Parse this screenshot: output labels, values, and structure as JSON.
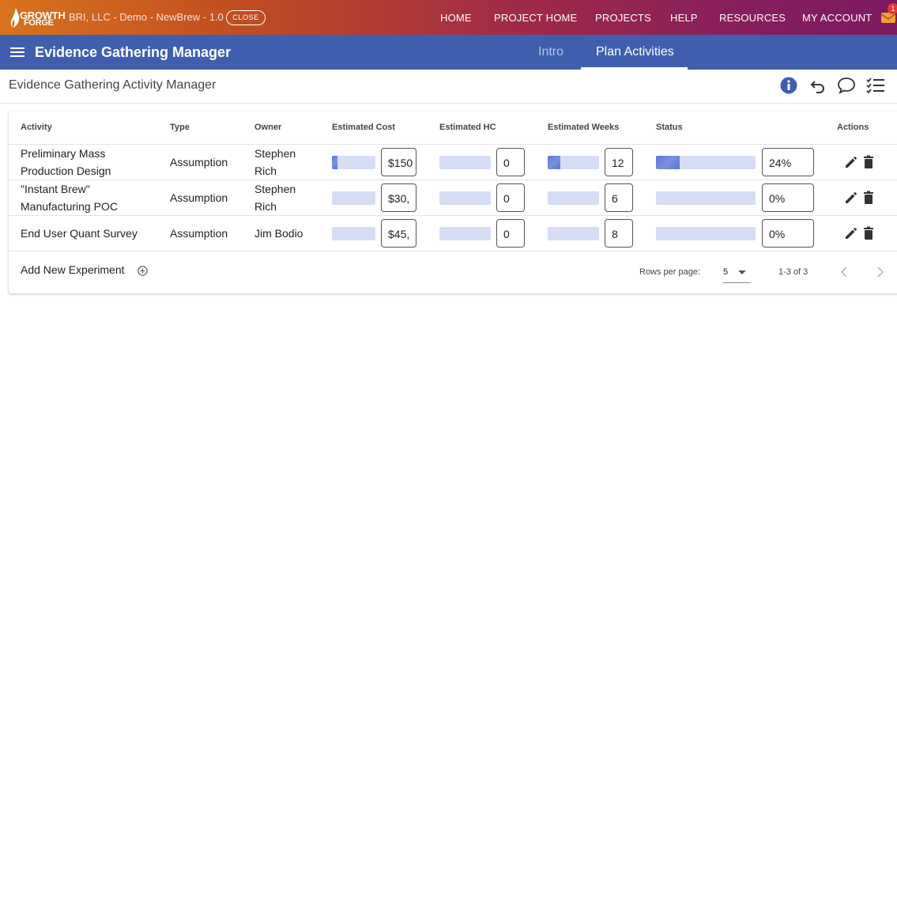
{
  "topbar": {
    "logo_line1": "GROWTH",
    "logo_line2": "FORGE",
    "project_name": "BRI, LLC - Demo - NewBrew - 1.0",
    "close_label": "CLOSE",
    "nav": [
      "HOME",
      "PROJECT HOME",
      "PROJECTS",
      "HELP",
      "RESOURCES",
      "MY ACCOUNT"
    ],
    "mail_badge": "1",
    "gradient_colors": [
      "#d9731c",
      "#7d1a60"
    ]
  },
  "appbar": {
    "title": "Evidence Gathering Manager",
    "tabs": [
      {
        "label": "Intro",
        "active": false
      },
      {
        "label": "Plan Activities",
        "active": true
      }
    ],
    "color": "#3f5fae"
  },
  "subheader": {
    "title": "Evidence Gathering Activity Manager",
    "tools": [
      "info-icon",
      "undo-icon",
      "comment-icon",
      "checklist-icon"
    ]
  },
  "table": {
    "headers": [
      "Activity",
      "Type",
      "Owner",
      "Estimated Cost",
      "Estimated HC",
      "Estimated Weeks",
      "Status",
      "Actions"
    ],
    "rows": [
      {
        "activity_line1": "Preliminary Mass",
        "activity_line2": "Production Design",
        "type": "Assumption",
        "owner_line1": "Stephen",
        "owner_line2": "Rich",
        "cost": "$150",
        "cost_fill": 0.12,
        "hc": "0",
        "hc_fill": 0,
        "weeks": "12",
        "weeks_fill": 0.25,
        "status": "24%",
        "status_fill": 0.24
      },
      {
        "activity_line1": "\"Instant Brew\"",
        "activity_line2": "Manufacturing POC",
        "type": "Assumption",
        "owner_line1": "Stephen",
        "owner_line2": "Rich",
        "cost": "$30,",
        "cost_fill": 0,
        "hc": "0",
        "hc_fill": 0,
        "weeks": "6",
        "weeks_fill": 0,
        "status": "0%",
        "status_fill": 0
      },
      {
        "activity_line1": "End User Quant Survey",
        "activity_line2": "",
        "type": "Assumption",
        "owner_line1": "Jim Bodio",
        "owner_line2": "",
        "cost": "$45,",
        "cost_fill": 0,
        "hc": "0",
        "hc_fill": 0,
        "weeks": "8",
        "weeks_fill": 0,
        "status": "0%",
        "status_fill": 0
      }
    ],
    "add_label": "Add New Experiment",
    "rows_per_page_label": "Rows per page:",
    "rows_per_page": "5",
    "range": "1-3 of 3"
  }
}
